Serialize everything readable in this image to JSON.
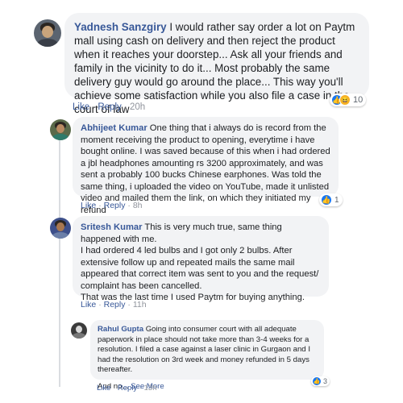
{
  "comments": [
    {
      "author": "Yadnesh Sanzgiry",
      "text": " I would rather say order a lot on Paytm mall using cash on delivery and then reject the product when it reaches your doorstep... Ask all your friends and family in the vicinity to do it... Most probably the same delivery guy would go around the place... This way you'll achieve some satisfaction while you also file a case in the court of law",
      "like_label": "Like",
      "reply_label": "Reply",
      "time": "20h",
      "reaction_count": "10"
    },
    {
      "author": "Abhijeet Kumar",
      "text": " One thing that i always do is record from the moment receiving the product to opening, everytime i have bought online. I was saved because of this when i had ordered a jbl headphones amounting rs 3200 approximately, and was sent a probably 100 bucks Chinese earphones. Was told the same thing, i uploaded the video on YouTube, made it unlisted video and mailed them the link, on which they initiated my refund",
      "like_label": "Like",
      "reply_label": "Reply",
      "time": "8h",
      "reaction_count": "1"
    },
    {
      "author": "Sritesh Kumar",
      "text": " This is very much true, same thing happened with me.",
      "text2": "I had ordered 4 led bulbs and I got only 2 bulbs. After extensive follow up and repeated mails the same mail appeared that correct item was sent to you and the request/ complaint has been cancelled.",
      "text3": "That was the last time I used Paytm for buying anything.",
      "like_label": "Like",
      "reply_label": "Reply",
      "time": "11h"
    },
    {
      "author": "Rahul Gupta",
      "text": " Going into consumer court with all adequate paperwork in place should not take more than 3-4 weeks for a resolution. I filed a case against a laser clinic in Gurgaon and I had the resolution on 3rd week and money refunded in 5 days thereafter.",
      "text2": "And no...",
      "see_more": "See More",
      "like_label": "Like",
      "reply_label": "Reply",
      "time": "13h",
      "reaction_count": "3"
    }
  ],
  "colors": {
    "name": "#385898",
    "bubble": "#f2f3f5",
    "like_reaction": "#1877f2",
    "haha_reaction": "#f7b125"
  },
  "icons": [
    "avatar",
    "like-reaction-icon",
    "haha-reaction-icon"
  ]
}
